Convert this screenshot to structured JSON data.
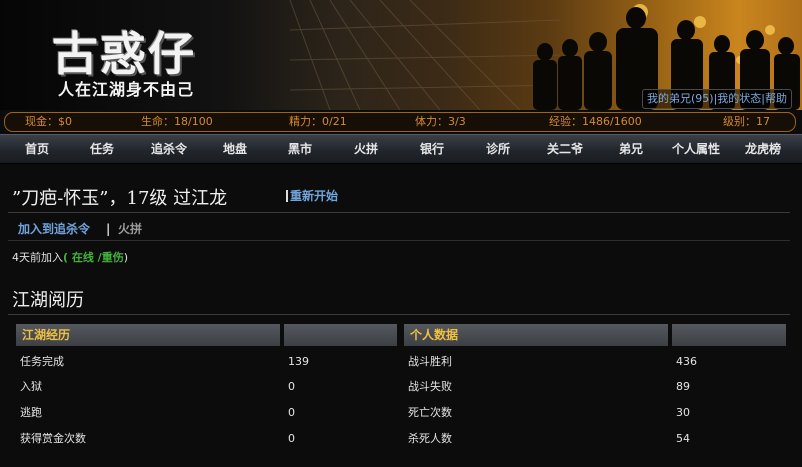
{
  "brand": {
    "title": "古惑仔",
    "slogan": "人在江湖身不由己"
  },
  "top_links": [
    "我的弟兄(95)",
    "我的状态",
    "帮助"
  ],
  "stats": {
    "cash": "现金：$0",
    "life": "生命：18/100",
    "energy": "精力：0/21",
    "stamina": "体力：3/3",
    "exp": "经验：1486/1600",
    "level": "级别：17"
  },
  "nav": [
    "首页",
    "任务",
    "追杀令",
    "地盘",
    "黑市",
    "火拼",
    "银行",
    "诊所",
    "关二爷",
    "弟兄",
    "个人属性",
    "龙虎榜"
  ],
  "profile": {
    "name_line": "”刀疤-怀玉”，17级 过江龙",
    "restart": "重新开始",
    "add_hunt": "加入到追杀令",
    "separator": "|",
    "fight": "火拼",
    "joined_prefix": "4天前加入",
    "status": "( 在线 /重伤",
    "status_close": ")"
  },
  "history": {
    "section_title": "江湖阅历",
    "left_header": "江湖经历",
    "right_header": "个人数据",
    "left_rows": [
      {
        "label": "任务完成",
        "value": "139"
      },
      {
        "label": "入狱",
        "value": "0"
      },
      {
        "label": "逃跑",
        "value": "0"
      },
      {
        "label": "获得赏金次数",
        "value": "0"
      }
    ],
    "right_rows": [
      {
        "label": "战斗胜利",
        "value": "436"
      },
      {
        "label": "战斗失败",
        "value": "89"
      },
      {
        "label": "死亡次数",
        "value": "30"
      },
      {
        "label": "杀死人数",
        "value": "54"
      }
    ]
  }
}
